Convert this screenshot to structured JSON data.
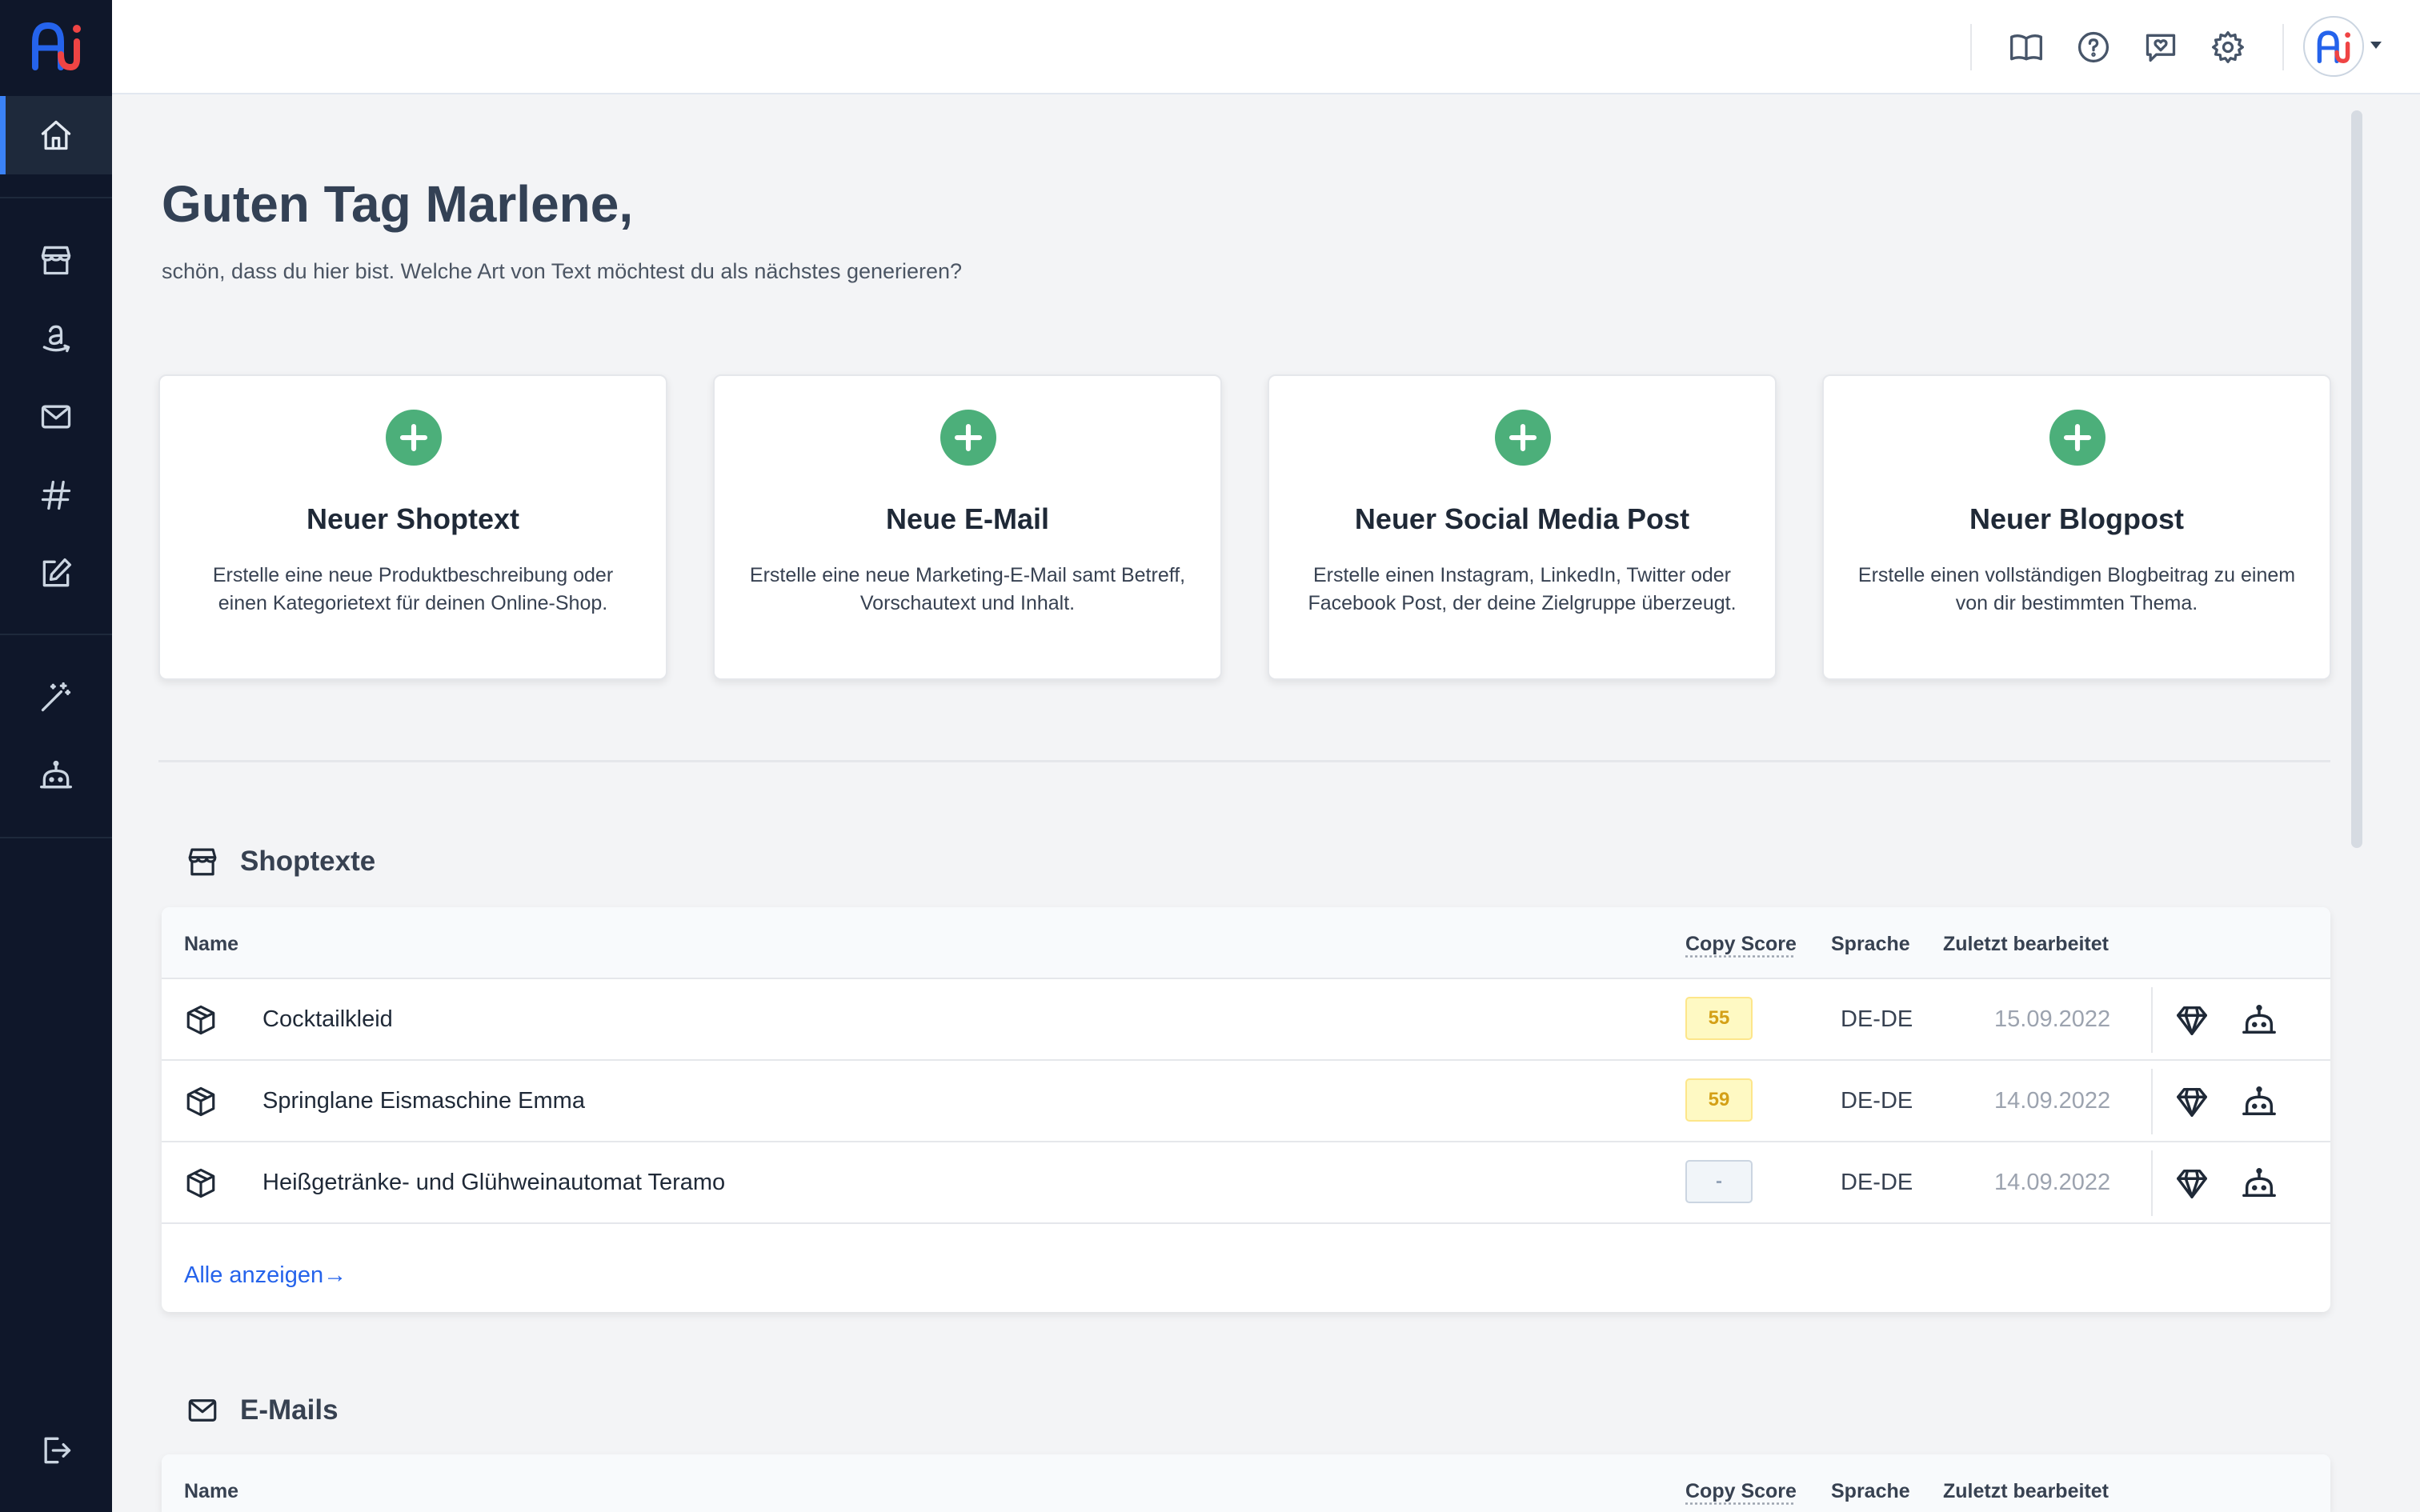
{
  "app": {
    "logo_text": "Ai"
  },
  "greeting": {
    "title": "Guten Tag Marlene,",
    "subtitle": "schön, dass du hier bist. Welche Art von Text möchtest du als nächstes generieren?"
  },
  "cards": [
    {
      "title": "Neuer Shoptext",
      "desc": "Erstelle eine neue Produktbeschreibung oder einen Kategorietext für deinen Online-Shop."
    },
    {
      "title": "Neue E-Mail",
      "desc": "Erstelle eine neue Marketing-E-Mail samt Betreff, Vorschautext und Inhalt."
    },
    {
      "title": "Neuer Social Media Post",
      "desc": "Erstelle einen Instagram, LinkedIn, Twitter oder Facebook Post, der deine Zielgruppe überzeugt."
    },
    {
      "title": "Neuer Blogpost",
      "desc": "Erstelle einen vollständigen Blogbeitrag zu einem von dir bestimmten Thema."
    }
  ],
  "columns": {
    "name": "Name",
    "score": "Copy Score",
    "lang": "Sprache",
    "date": "Zuletzt bearbeitet"
  },
  "shoptexte": {
    "title": "Shoptexte",
    "rows": [
      {
        "name": "Cocktailkleid",
        "score": "55",
        "lang": "DE-DE",
        "date": "15.09.2022"
      },
      {
        "name": "Springlane Eismaschine Emma",
        "score": "59",
        "lang": "DE-DE",
        "date": "14.09.2022"
      },
      {
        "name": "Heißgetränke- und Glühweinautomat Teramo",
        "score": "-",
        "lang": "DE-DE",
        "date": "14.09.2022"
      }
    ],
    "show_all": "Alle anzeigen→"
  },
  "emails": {
    "title": "E-Mails"
  },
  "colors": {
    "sidebar": "#0f172a",
    "accent": "#3b82f6",
    "plus": "#4caf7a",
    "link": "#2563eb"
  }
}
